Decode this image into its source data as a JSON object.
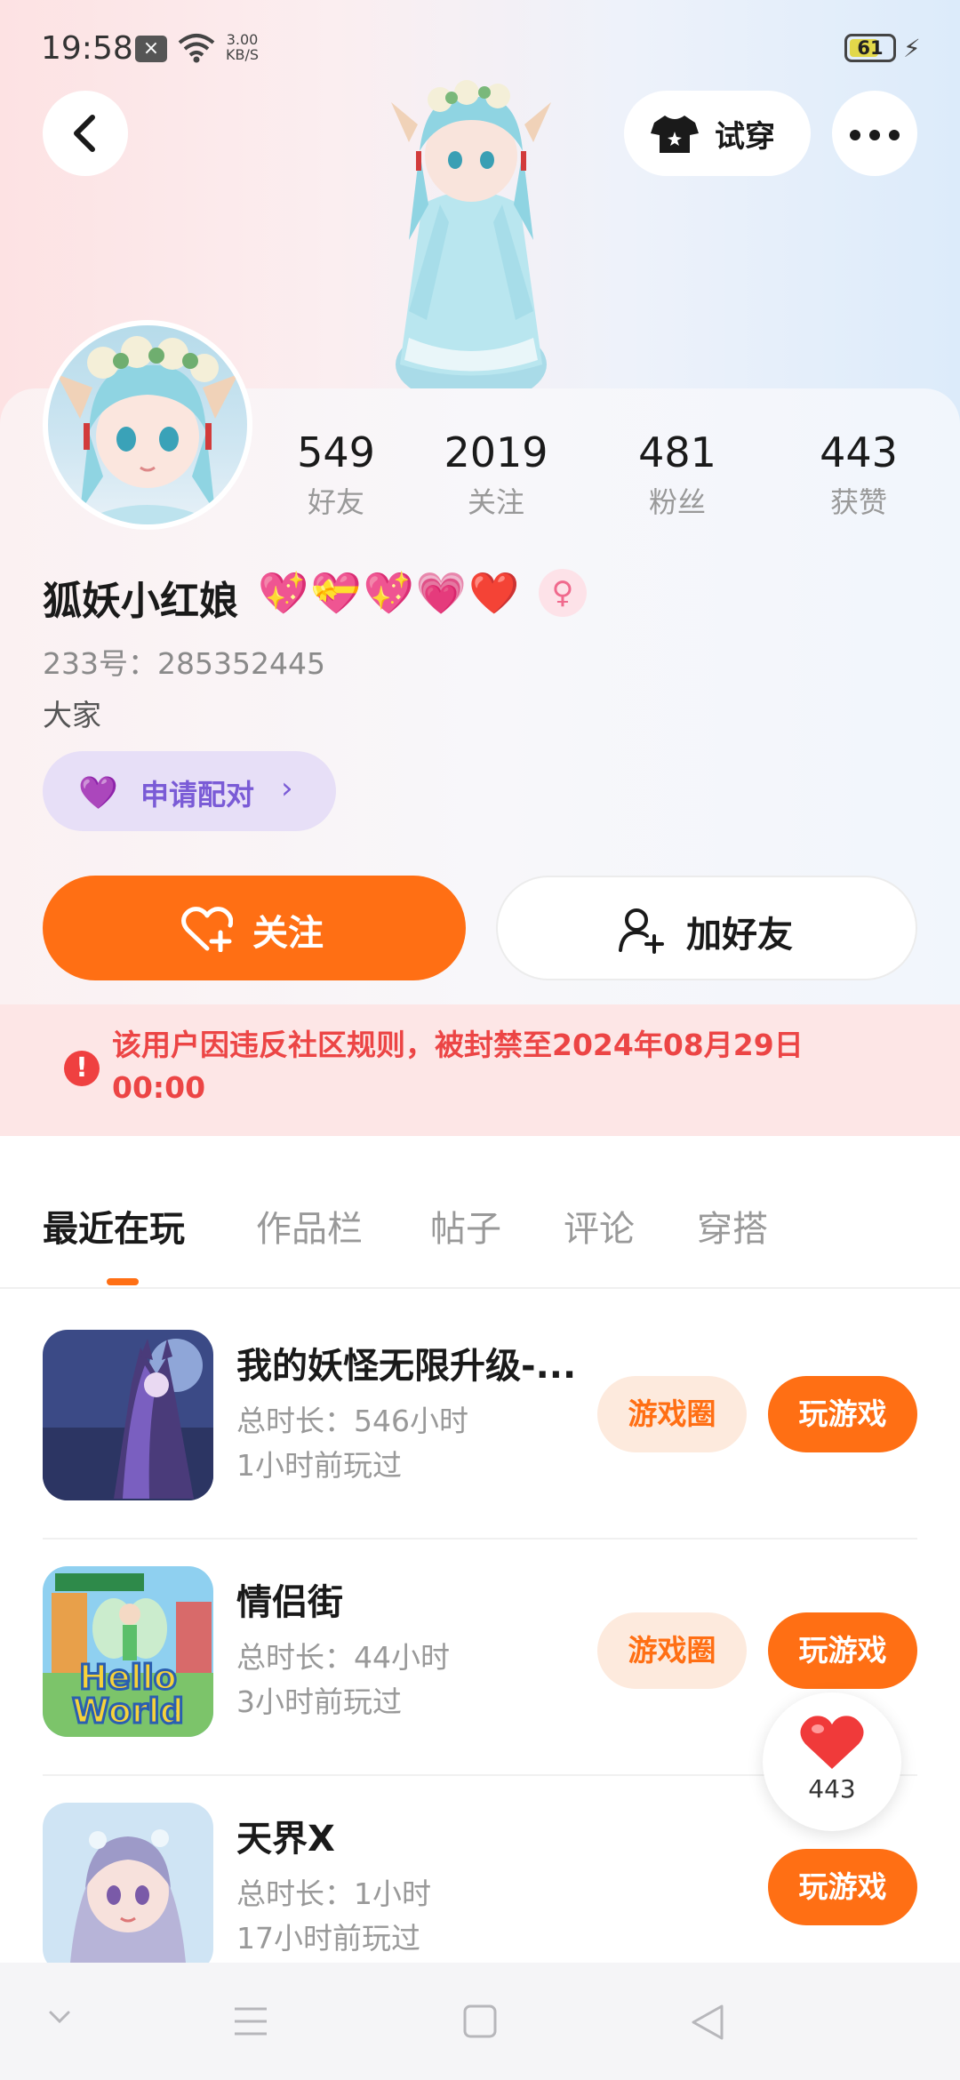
{
  "status_bar": {
    "time": "19:58",
    "x_icon": "×",
    "speed_value": "3.00",
    "speed_unit": "KB/S",
    "battery": "61"
  },
  "header": {
    "tryon_label": "试穿"
  },
  "profile": {
    "stats": [
      {
        "value": "549",
        "label": "好友"
      },
      {
        "value": "2019",
        "label": "关注"
      },
      {
        "value": "481",
        "label": "粉丝"
      },
      {
        "value": "443",
        "label": "获赞"
      }
    ],
    "username": "狐妖小红娘",
    "heart_emojis": "💖💝💖💗❤️",
    "gender_symbol": "♀",
    "id_line": "233号：285352445",
    "bio": "大家",
    "pair_label": "申请配对"
  },
  "actions": {
    "follow_label": "关注",
    "add_friend_label": "加好友"
  },
  "ban_notice": {
    "text": "该用户因违反社区规则，被封禁至2024年08月29日 00:00"
  },
  "tabs": [
    "最近在玩",
    "作品栏",
    "帖子",
    "评论",
    "穿搭"
  ],
  "games": [
    {
      "title": "我的妖怪无限升级-...",
      "duration": "总时长：546小时",
      "last_played": "1小时前玩过",
      "circle_label": "游戏圈",
      "play_label": "玩游戏"
    },
    {
      "title": "情侣街",
      "duration": "总时长：44小时",
      "last_played": "3小时前玩过",
      "circle_label": "游戏圈",
      "play_label": "玩游戏"
    },
    {
      "title": "天界X",
      "duration": "总时长：1小时",
      "last_played": "17小时前玩过",
      "play_label": "玩游戏"
    }
  ],
  "thumbnail_text": {
    "hello": "Hello",
    "world": "World"
  },
  "like_float": {
    "count": "443"
  },
  "colors": {
    "accent": "#ff6f14",
    "ban_text": "#ec4545",
    "pair": "#7a5bd6"
  },
  "icons": {
    "back": "chevron-left-icon",
    "tryon": "tshirt-icon",
    "more": "more-dots-icon",
    "follow": "heart-plus-icon",
    "add_friend": "person-add-icon",
    "ban": "exclamation-icon",
    "like": "heart-icon"
  }
}
